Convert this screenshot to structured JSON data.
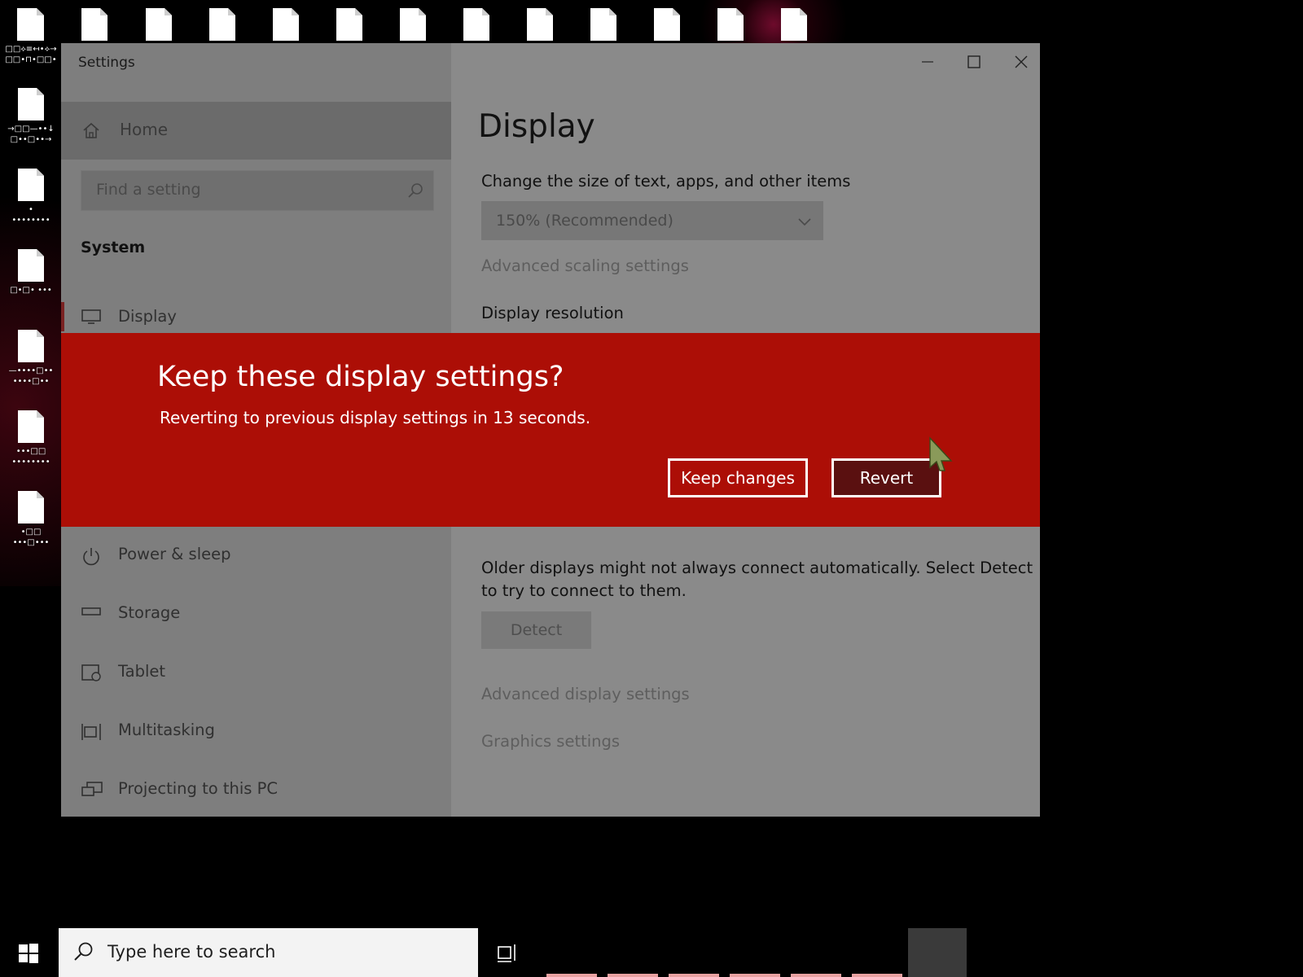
{
  "desktop": {
    "icon_labels": [
      [
        "□□⟡≡↤•⟡→",
        "□□•⊓•□□•"
      ],
      [
        "→□□—••↓",
        "□••□••→"
      ],
      [
        "•",
        "••••••••"
      ],
      [
        "□•□• •••",
        ""
      ],
      [
        "—••••□••",
        "••••□••"
      ],
      [
        "•••□□",
        "••••••••"
      ],
      [
        "•□□",
        "•••□•••"
      ]
    ]
  },
  "window": {
    "title": "Settings",
    "controls": {
      "minimize": "minimize-icon",
      "maximize": "maximize-icon",
      "close": "close-icon"
    }
  },
  "nav": {
    "home_label": "Home",
    "search_placeholder": "Find a setting",
    "section": "System",
    "items": [
      {
        "label": "Display",
        "icon": "monitor-icon"
      },
      {
        "label": "Power & sleep",
        "icon": "power-icon"
      },
      {
        "label": "Storage",
        "icon": "storage-icon"
      },
      {
        "label": "Tablet",
        "icon": "tablet-icon"
      },
      {
        "label": "Multitasking",
        "icon": "multitasking-icon"
      },
      {
        "label": "Projecting to this PC",
        "icon": "projecting-icon"
      }
    ]
  },
  "content": {
    "page_title": "Display",
    "scale_label": "Change the size of text, apps, and other items",
    "scale_value": "150% (Recommended)",
    "advanced_scaling": "Advanced scaling settings",
    "resolution_label": "Display resolution",
    "older_displays": "Older displays might not always connect automatically. Select Detect",
    "older_displays_2": "to try to connect to them.",
    "detect_button": "Detect",
    "advanced_display": "Advanced display settings",
    "graphics_settings": "Graphics settings"
  },
  "dialog": {
    "title": "Keep these display settings?",
    "message": "Reverting to previous display settings in 13 seconds.",
    "keep_button": "Keep changes",
    "revert_button": "Revert",
    "countdown_seconds": 13
  },
  "taskbar": {
    "search_placeholder": "Type here to search"
  },
  "colors": {
    "banner": "#ac0e06",
    "revert_bg": "#5a1010"
  }
}
